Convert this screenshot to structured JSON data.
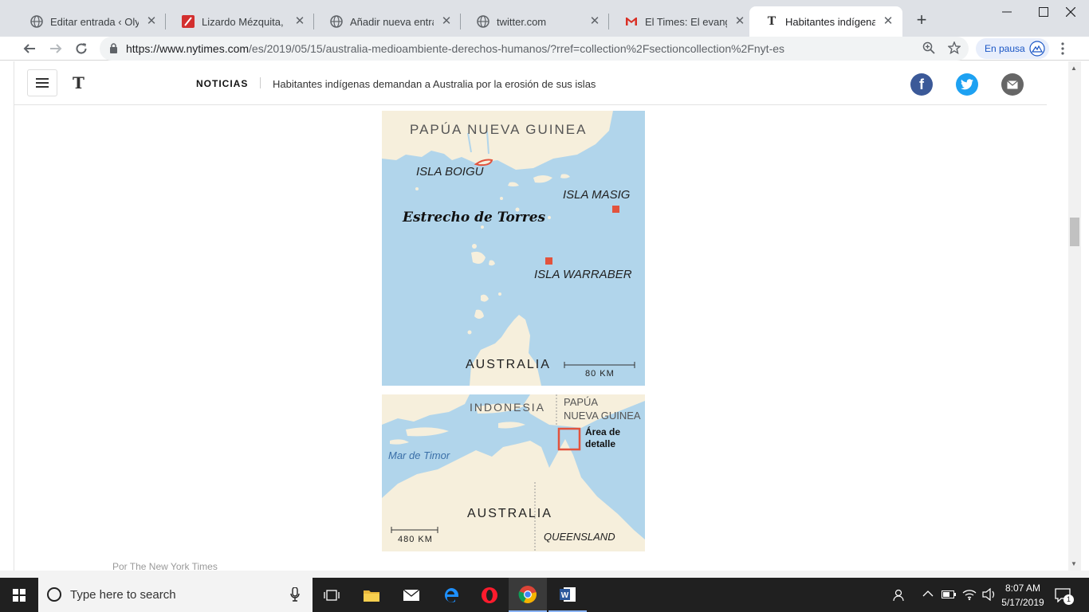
{
  "browser": {
    "tabs": [
      {
        "title": "Editar entrada ‹ Olympi",
        "icon": "globe-icon"
      },
      {
        "title": "Lizardo Mézquita, Banq",
        "icon": "slash-icon"
      },
      {
        "title": "Añadir nueva entrada ‹",
        "icon": "globe-icon"
      },
      {
        "title": "twitter.com",
        "icon": "globe-icon"
      },
      {
        "title": "El Times: El evangelio d",
        "icon": "gmail-icon"
      },
      {
        "title": "Habitantes indígenas d",
        "icon": "nyt-icon",
        "active": true
      }
    ],
    "url_host": "https://www.nytimes.com",
    "url_path": "/es/2019/05/15/australia-medioambiente-derechos-humanos/?rref=collection%2Fsectioncollection%2Fnyt-es",
    "profile_label": "En pausa"
  },
  "header": {
    "logo": "T",
    "section": "NOTICIAS",
    "headline": "Habitantes indígenas demandan a Australia por la erosión de sus islas"
  },
  "map_detail": {
    "png": "PAPÚA NUEVA GUINEA",
    "boigu": "ISLA BOIGU",
    "masig": "ISLA MASIG",
    "strait": "Estrecho de Torres",
    "warraber": "ISLA WARRABER",
    "australia": "AUSTRALIA",
    "scale": "80 KM"
  },
  "map_overview": {
    "indonesia": "INDONESIA",
    "png_line1": "PAPÚA",
    "png_line2": "NUEVA GUINEA",
    "detail_line1": "Área de",
    "detail_line2": "detalle",
    "timor": "Mar de Timor",
    "australia": "AUSTRALIA",
    "queensland": "QUEENSLAND",
    "scale": "480 KM"
  },
  "credit": "Por The New York Times",
  "taskbar": {
    "search_placeholder": "Type here to search",
    "time": "8:07 AM",
    "date": "5/17/2019",
    "notifications": "1"
  },
  "colors": {
    "water": "#b1d5eb",
    "land": "#f6efdc",
    "marker": "#e2533d",
    "facebook": "#3b5998",
    "twitter": "#1da1f2",
    "email": "#666666"
  }
}
